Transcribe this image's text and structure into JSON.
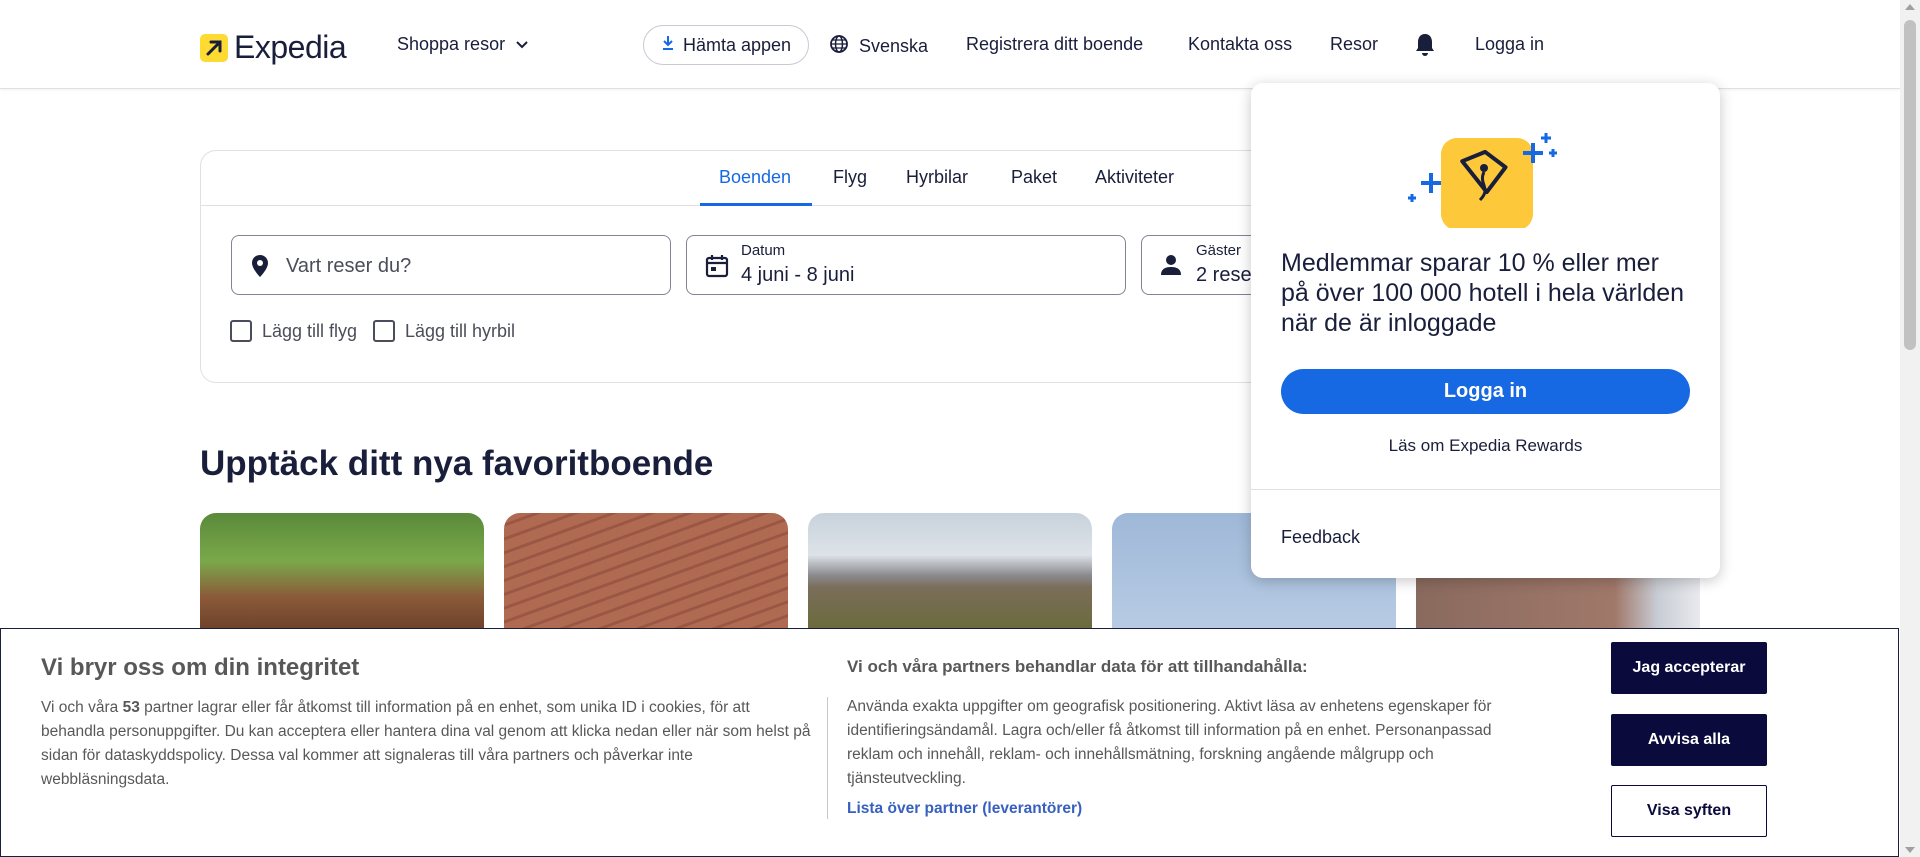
{
  "header": {
    "logo_text": "Expedia",
    "shop_label": "Shoppa resor",
    "app_label": "Hämta appen",
    "language_label": "Svenska",
    "register_label": "Registrera ditt boende",
    "contact_label": "Kontakta oss",
    "trips_label": "Resor",
    "login_label": "Logga in"
  },
  "search": {
    "tabs": [
      "Boenden",
      "Flyg",
      "Hyrbilar",
      "Paket",
      "Aktiviteter"
    ],
    "active_tab": "Boenden",
    "destination_placeholder": "Vart reser du?",
    "date_label": "Datum",
    "date_value": "4 juni - 8 juni",
    "guests_label": "Gäster",
    "guests_value": "2 resenärer",
    "add_flight_label": "Lägg till flyg",
    "add_car_label": "Lägg till hyrbil"
  },
  "section": {
    "title": "Upptäck ditt nya favoritboende"
  },
  "popover": {
    "text": "Medlemmar sparar 10 % eller mer på över 100 000 hotell i hela världen när de är inloggade",
    "login_button": "Logga in",
    "rewards_link": "Läs om Expedia Rewards",
    "feedback": "Feedback"
  },
  "cookie": {
    "title": "Vi bryr oss om din integritet",
    "body_prefix": "Vi och våra ",
    "partner_count": "53",
    "body_suffix": " partner lagrar eller får åtkomst till information på en enhet, som unika ID i cookies, för att behandla personuppgifter. Du kan acceptera eller hantera dina val genom att klicka nedan eller när som helst på sidan för dataskyddspolicy. Dessa val kommer att signaleras till våra partners och påverkar inte webbläsningsdata.",
    "subtitle": "Vi och våra partners behandlar data för att tillhandahålla:",
    "purposes": "Använda exakta uppgifter om geografisk positionering. Aktivt läsa av enhetens egenskaper för identifieringsändamål. Lagra och/eller få åtkomst till information på en enhet. Personanpassad reklam och innehåll, reklam- och innehållsmätning, forskning angående målgrupp och tjänsteutveckling.",
    "partners_link": "Lista över partner (leverantörer)",
    "accept_button": "Jag accepterar",
    "reject_button": "Avvisa alla",
    "purposes_button": "Visa syften"
  },
  "colors": {
    "accent": "#1668e3",
    "brand_yellow": "#fddb32",
    "navy": "#191e3b",
    "cookie_button": "#0a0a3c"
  }
}
